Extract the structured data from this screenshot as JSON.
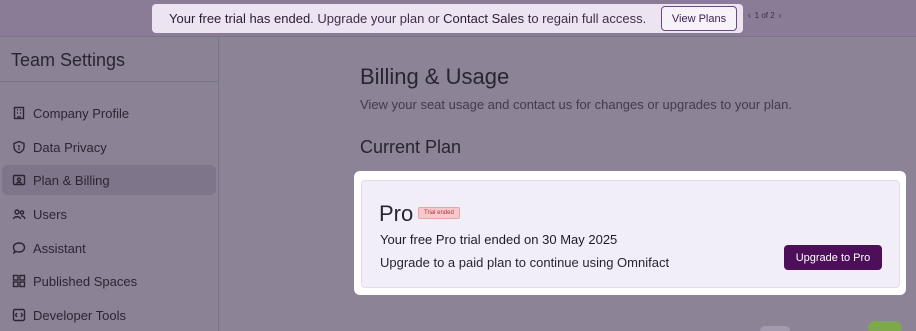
{
  "banner": {
    "part1": "Your free trial has ended.",
    "part2": " Upgrade your plan or ",
    "part3": "Contact Sales",
    "part4": " to regain full access.",
    "button": "View Plans",
    "pager": {
      "prev": "‹",
      "text": "1 of 2",
      "next": "›"
    }
  },
  "sidebar": {
    "title": "Team Settings",
    "items": [
      {
        "label": "Company Profile",
        "icon": "building-icon"
      },
      {
        "label": "Data Privacy",
        "icon": "shield-icon"
      },
      {
        "label": "Plan & Billing",
        "icon": "billing-icon",
        "active": true
      },
      {
        "label": "Users",
        "icon": "users-icon"
      },
      {
        "label": "Assistant",
        "icon": "chat-icon"
      },
      {
        "label": "Published Spaces",
        "icon": "grid-icon"
      },
      {
        "label": "Developer Tools",
        "icon": "code-icon"
      }
    ]
  },
  "main": {
    "title": "Billing & Usage",
    "subtitle": "View your seat usage and contact us for changes or upgrades to your plan.",
    "section": "Current Plan",
    "card": {
      "plan": "Pro",
      "badge": "Trial ended",
      "line1": "Your free Pro trial ended on 30 May 2025",
      "line2": "Upgrade to a paid plan to continue using Omnifact",
      "button": "Upgrade to Pro"
    }
  },
  "colors": {
    "accent": "#4d0f5a",
    "badge_bg": "#f6c9cd",
    "badge_text": "#b23040"
  }
}
